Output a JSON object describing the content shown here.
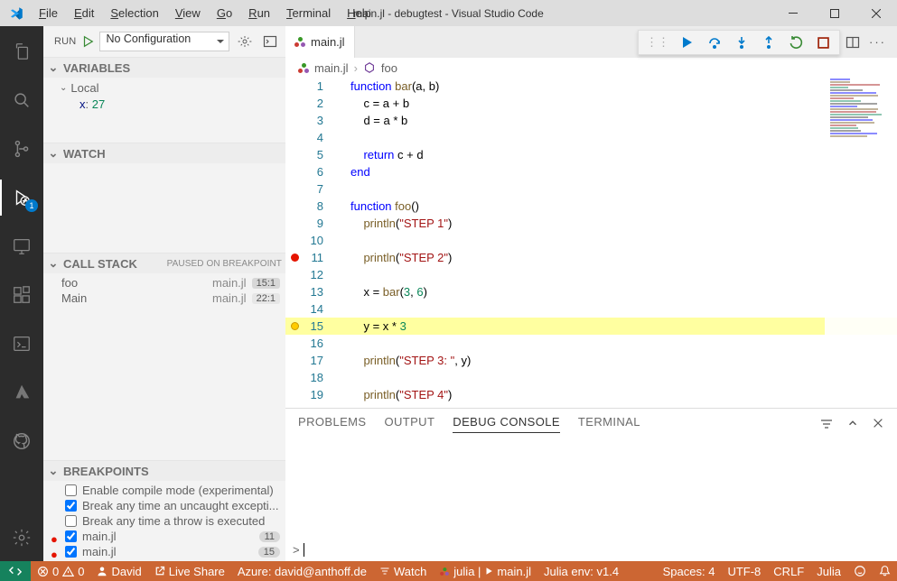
{
  "titlebar": {
    "title": "main.jl - debugtest - Visual Studio Code",
    "menus": [
      "File",
      "Edit",
      "Selection",
      "View",
      "Go",
      "Run",
      "Terminal",
      "Help"
    ]
  },
  "activitybar": {
    "debug_badge": "1"
  },
  "sidebar": {
    "run": {
      "label": "RUN",
      "config": "No Configuration"
    },
    "sections": {
      "variables": "VARIABLES",
      "watch": "WATCH",
      "callstack": "CALL STACK",
      "callstack_status": "PAUSED ON BREAKPOINT",
      "breakpoints": "BREAKPOINTS"
    },
    "variables": {
      "scope": "Local",
      "items": [
        {
          "name": "x",
          "value": "27"
        }
      ]
    },
    "callstack": [
      {
        "name": "foo",
        "source": "main.jl",
        "loc": "15:1",
        "top": true
      },
      {
        "name": "Main",
        "source": "main.jl",
        "loc": "22:1",
        "top": false
      }
    ],
    "breakpoints": {
      "options": [
        {
          "label": "Enable compile mode (experimental)",
          "checked": false
        },
        {
          "label": "Break any time an uncaught excepti...",
          "checked": true
        },
        {
          "label": "Break any time a throw is executed",
          "checked": false
        }
      ],
      "items": [
        {
          "label": "main.jl",
          "line": "11",
          "checked": true
        },
        {
          "label": "main.jl",
          "line": "15",
          "checked": true
        }
      ]
    }
  },
  "editor": {
    "tab": {
      "filename": "main.jl"
    },
    "breadcrumb": {
      "file": "main.jl",
      "symbol": "foo"
    },
    "lines": [
      {
        "n": 1,
        "glyph": "",
        "html": "<span class='tk-kw'>function</span> <span class='tk-fn'>bar</span>(a, b)"
      },
      {
        "n": 2,
        "glyph": "",
        "html": "    c <span class='tk-op'>=</span> a <span class='tk-op'>+</span> b"
      },
      {
        "n": 3,
        "glyph": "",
        "html": "    d <span class='tk-op'>=</span> a <span class='tk-op'>*</span> b"
      },
      {
        "n": 4,
        "glyph": "",
        "html": ""
      },
      {
        "n": 5,
        "glyph": "",
        "html": "    <span class='tk-kw'>return</span> c <span class='tk-op'>+</span> d"
      },
      {
        "n": 6,
        "glyph": "",
        "html": "<span class='tk-end'>end</span>"
      },
      {
        "n": 7,
        "glyph": "",
        "html": ""
      },
      {
        "n": 8,
        "glyph": "",
        "html": "<span class='tk-kw'>function</span> <span class='tk-fn'>foo</span>()"
      },
      {
        "n": 9,
        "glyph": "",
        "html": "    <span class='tk-fn'>println</span>(<span class='tk-str'>\"STEP 1\"</span>)"
      },
      {
        "n": 10,
        "glyph": "",
        "html": ""
      },
      {
        "n": 11,
        "glyph": "bp",
        "html": "    <span class='tk-fn'>println</span>(<span class='tk-str'>\"STEP 2\"</span>)"
      },
      {
        "n": 12,
        "glyph": "",
        "html": ""
      },
      {
        "n": 13,
        "glyph": "",
        "html": "    x <span class='tk-op'>=</span> <span class='tk-fn'>bar</span>(<span class='tk-num'>3</span>, <span class='tk-num'>6</span>)"
      },
      {
        "n": 14,
        "glyph": "",
        "html": ""
      },
      {
        "n": 15,
        "glyph": "cur",
        "html": "    y <span class='tk-op'>=</span> x <span class='tk-op'>*</span> <span class='tk-num'>3</span>",
        "current": true
      },
      {
        "n": 16,
        "glyph": "",
        "html": ""
      },
      {
        "n": 17,
        "glyph": "",
        "html": "    <span class='tk-fn'>println</span>(<span class='tk-str'>\"STEP 3: \"</span>, y)"
      },
      {
        "n": 18,
        "glyph": "",
        "html": ""
      },
      {
        "n": 19,
        "glyph": "",
        "html": "    <span class='tk-fn'>println</span>(<span class='tk-str'>\"STEP 4\"</span>)"
      }
    ]
  },
  "panel": {
    "tabs": [
      "PROBLEMS",
      "OUTPUT",
      "DEBUG CONSOLE",
      "TERMINAL"
    ],
    "active": "DEBUG CONSOLE",
    "prompt": ">"
  },
  "statusbar": {
    "left": {
      "errors": "0",
      "warnings": "0",
      "user": "David",
      "liveshare": "Live Share",
      "azure": "Azure: david@anthoff.de",
      "watch": "Watch",
      "julia_file": "julia |",
      "julia_main": "main.jl",
      "julia_env": "Julia env: v1.4"
    },
    "right": {
      "spaces": "Spaces: 4",
      "encoding": "UTF-8",
      "eol": "CRLF",
      "lang": "Julia"
    }
  }
}
